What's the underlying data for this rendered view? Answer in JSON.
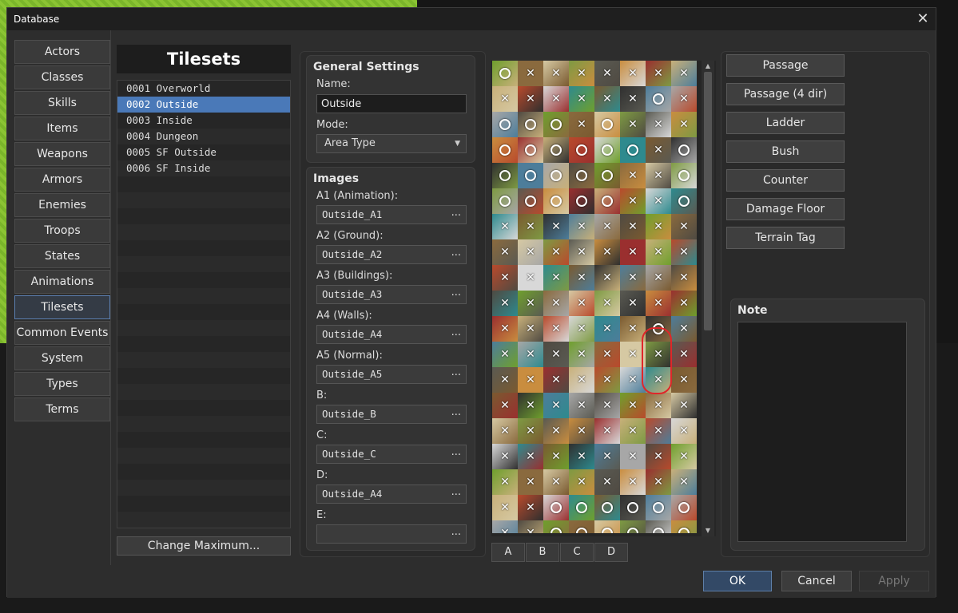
{
  "window": {
    "title": "Database",
    "close_label": "✕"
  },
  "categories": [
    {
      "label": "Actors"
    },
    {
      "label": "Classes"
    },
    {
      "label": "Skills"
    },
    {
      "label": "Items"
    },
    {
      "label": "Weapons"
    },
    {
      "label": "Armors"
    },
    {
      "label": "Enemies"
    },
    {
      "label": "Troops"
    },
    {
      "label": "States"
    },
    {
      "label": "Animations"
    },
    {
      "label": "Tilesets",
      "active": true
    },
    {
      "label": "Common Events"
    },
    {
      "label": "System"
    },
    {
      "label": "Types"
    },
    {
      "label": "Terms"
    }
  ],
  "tilesets": {
    "header": "Tilesets",
    "items": [
      {
        "label": "0001 Overworld"
      },
      {
        "label": "0002 Outside",
        "selected": true
      },
      {
        "label": "0003 Inside"
      },
      {
        "label": "0004 Dungeon"
      },
      {
        "label": "0005 SF Outside"
      },
      {
        "label": "0006 SF Inside"
      }
    ],
    "change_max_label": "Change Maximum..."
  },
  "general": {
    "title": "General Settings",
    "name_label": "Name:",
    "name_value": "Outside",
    "mode_label": "Mode:",
    "mode_value": "Area Type"
  },
  "images": {
    "title": "Images",
    "fields": [
      {
        "label": "A1 (Animation):",
        "value": "Outside_A1"
      },
      {
        "label": "A2 (Ground):",
        "value": "Outside_A2"
      },
      {
        "label": "A3 (Buildings):",
        "value": "Outside_A3"
      },
      {
        "label": "A4 (Walls):",
        "value": "Outside_A4"
      },
      {
        "label": "A5 (Normal):",
        "value": "Outside_A5"
      },
      {
        "label": "B:",
        "value": "Outside_B"
      },
      {
        "label": "C:",
        "value": "Outside_C"
      },
      {
        "label": "D:",
        "value": "Outside_A4"
      },
      {
        "label": "E:",
        "value": ""
      }
    ],
    "browse_label": "..."
  },
  "tile_tabs": [
    "A",
    "B",
    "C",
    "D"
  ],
  "tile_grid": {
    "columns": 8,
    "rows": [
      [
        "o",
        "x",
        "x",
        "x",
        "x",
        "x",
        "x",
        "x"
      ],
      [
        "x",
        "x",
        "x",
        "x",
        "x",
        "x",
        "o",
        "x"
      ],
      [
        "o",
        "o",
        "o",
        "x",
        "o",
        "x",
        "x",
        "x"
      ],
      [
        "o",
        "o",
        "o",
        "o",
        "o",
        "o",
        "x",
        "o"
      ],
      [
        "o",
        "o",
        "o",
        "o",
        "o",
        "x",
        "x",
        "o"
      ],
      [
        "o",
        "o",
        "o",
        "o",
        "o",
        "x",
        "x",
        "o"
      ],
      [
        "x",
        "x",
        "x",
        "x",
        "x",
        "x",
        "x",
        "x"
      ],
      [
        "x",
        "x",
        "x",
        "x",
        "x",
        "x",
        "x",
        "x"
      ],
      [
        "x",
        "x",
        "x",
        "x",
        "x",
        "x",
        "x",
        "x"
      ],
      [
        "x",
        "x",
        "x",
        "x",
        "x",
        "x",
        "x",
        "x"
      ],
      [
        "x",
        "x",
        "x",
        "x",
        "x",
        "x",
        "o",
        "x"
      ],
      [
        "x",
        "x",
        "x",
        "x",
        "x",
        "x",
        "x",
        "x"
      ],
      [
        "x",
        "x",
        "x",
        "x",
        "x",
        "x",
        "x",
        "x"
      ],
      [
        "x",
        "x",
        "x",
        "x",
        "x",
        "x",
        "x",
        "x"
      ],
      [
        "x",
        "x",
        "x",
        "x",
        "x",
        "x",
        "x",
        "x"
      ],
      [
        "x",
        "x",
        "x",
        "x",
        "x",
        "x",
        "x",
        "x"
      ],
      [
        "x",
        "x",
        "x",
        "x",
        "x",
        "x",
        "x",
        "x"
      ],
      [
        "x",
        "x",
        "o",
        "o",
        "o",
        "o",
        "o",
        "o"
      ],
      [
        "x",
        "x",
        "o",
        "o",
        "o",
        "o",
        "o",
        "o"
      ],
      [
        "o",
        "o",
        "o",
        "o",
        "o",
        "o",
        "o",
        "o"
      ]
    ],
    "palette": [
      "#6f9f2d",
      "#4d7d9a",
      "#2e8a8e",
      "#c8b07a",
      "#5a5a52",
      "#8a6a3e",
      "#a7a7a7",
      "#7a5a30",
      "#b94a2c",
      "#c98d3f",
      "#d6c9a3",
      "#4f4a42",
      "#2f2f2f",
      "#d8d8d8",
      "#9a2f2f",
      "#7e9a43"
    ],
    "highlight_color": "#e0262a"
  },
  "passage_buttons": [
    "Passage",
    "Passage (4 dir)",
    "Ladder",
    "Bush",
    "Counter",
    "Damage Floor",
    "Terrain Tag"
  ],
  "note": {
    "title": "Note"
  },
  "footer": {
    "ok": "OK",
    "cancel": "Cancel",
    "apply": "Apply"
  }
}
